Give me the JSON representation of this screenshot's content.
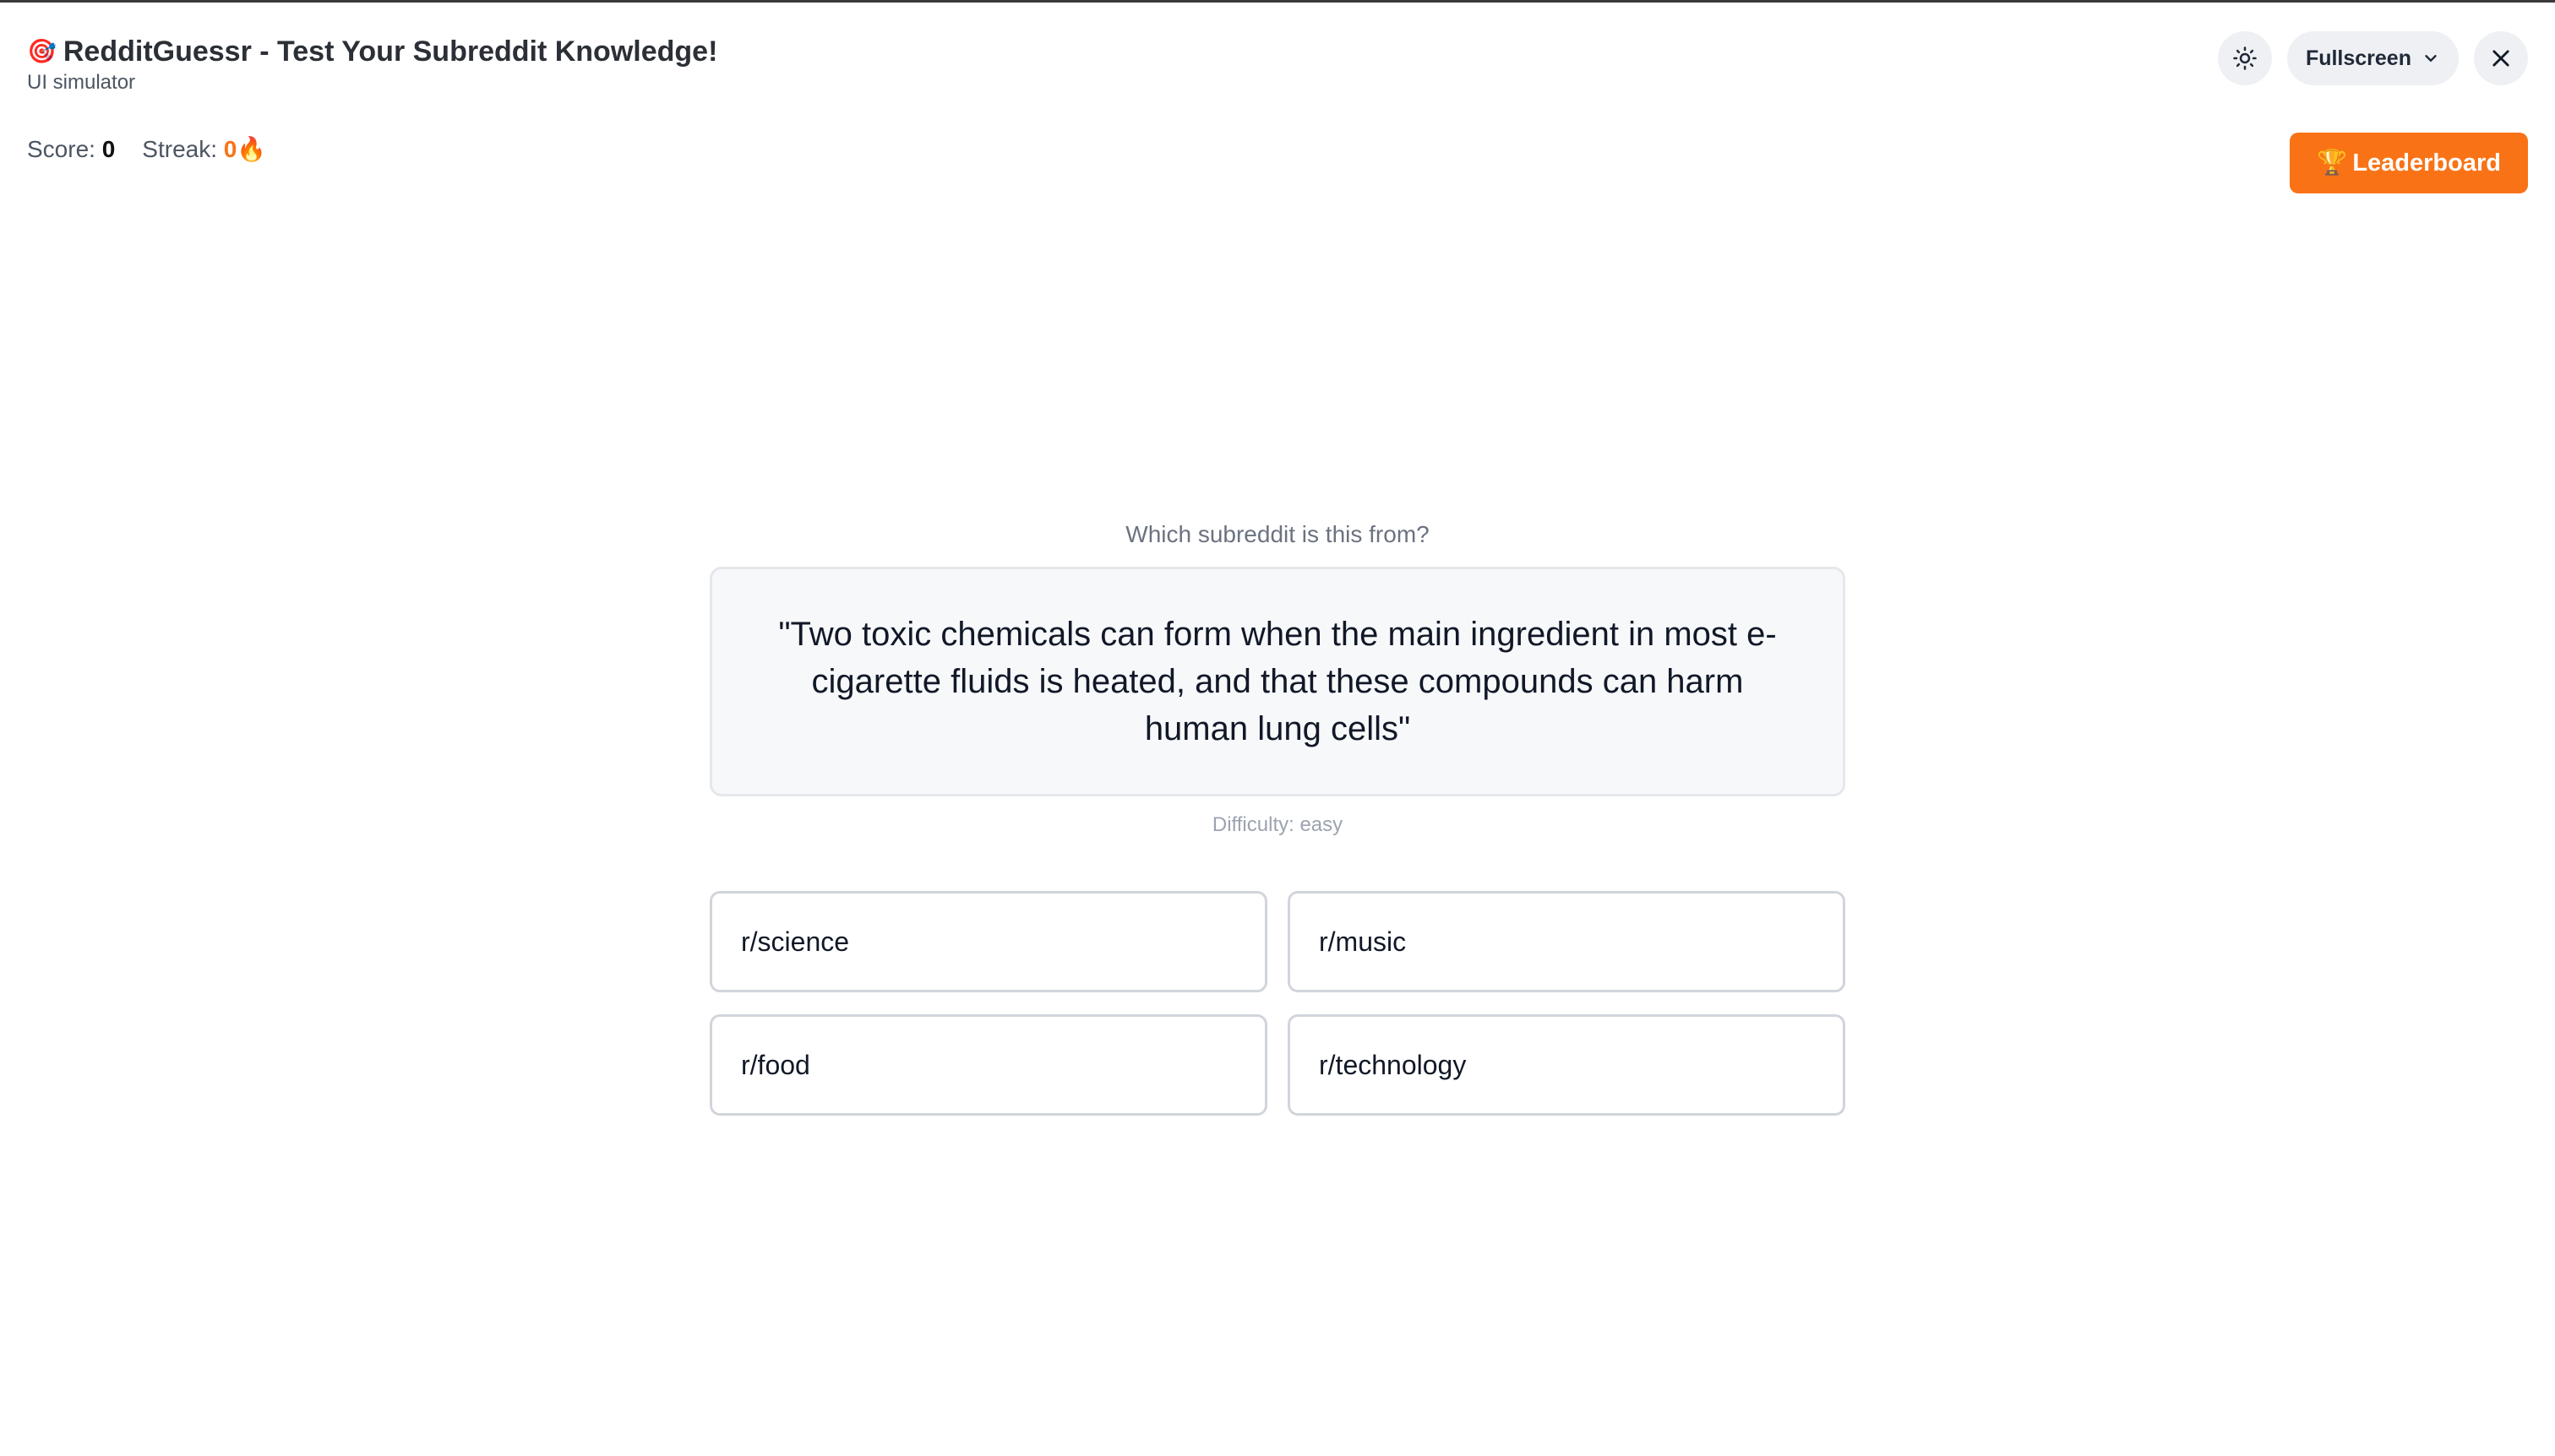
{
  "header": {
    "title_emoji": "🎯",
    "title": "RedditGuessr - Test Your Subreddit Knowledge!",
    "subtitle": "UI simulator"
  },
  "controls": {
    "theme_icon": "sun-icon",
    "fullscreen_label": "Fullscreen",
    "fullscreen_icon": "chevron-down-icon",
    "close_icon": "close-icon"
  },
  "stats": {
    "score_label": "Score:",
    "score_value": "0",
    "streak_label": "Streak:",
    "streak_value": "0🔥"
  },
  "leaderboard": {
    "icon": "🏆",
    "label": "Leaderboard"
  },
  "question": {
    "prompt": "Which subreddit is this from?",
    "quote": "\"Two toxic chemicals can form when the main ingredient in most e-cigarette fluids is heated, and that these compounds can harm human lung cells\"",
    "difficulty": "Difficulty: easy"
  },
  "options": [
    {
      "label": "r/science"
    },
    {
      "label": "r/music"
    },
    {
      "label": "r/food"
    },
    {
      "label": "r/technology"
    }
  ],
  "colors": {
    "accent": "#f97316",
    "card_bg": "#f7f8fa",
    "border": "#d1d5db"
  }
}
